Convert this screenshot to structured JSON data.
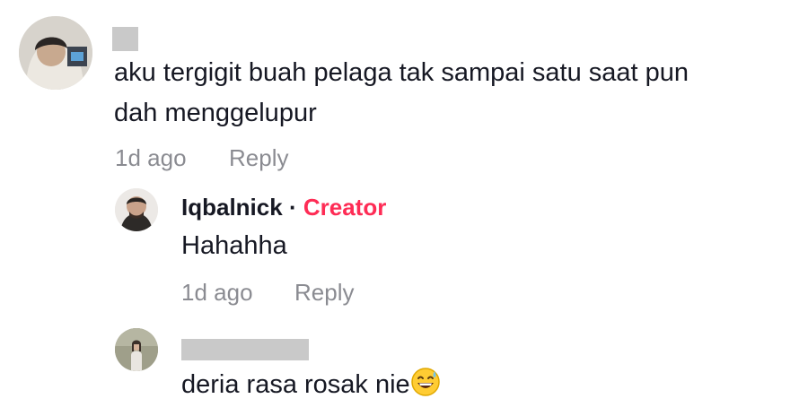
{
  "comment": {
    "text_line1": "aku tergigit buah pelaga tak sampai satu saat pun",
    "text_line2": "dah menggelupur",
    "time": "1d ago",
    "reply_label": "Reply"
  },
  "reply1": {
    "username": "Iqbalnick",
    "separator": "·",
    "badge": "Creator",
    "text": "Hahahha",
    "time": "1d ago",
    "reply_label": "Reply"
  },
  "reply2": {
    "text": "deria rasa rosak nie",
    "emoji": "sweat-smile-emoji"
  },
  "colors": {
    "creator": "#fe2c55",
    "text": "#161823",
    "muted": "rgba(22,24,35,0.5)",
    "redaction": "#c9c9c9"
  },
  "icons": [
    "user-avatar",
    "user-avatar",
    "user-avatar",
    "sweat-smile-emoji"
  ]
}
